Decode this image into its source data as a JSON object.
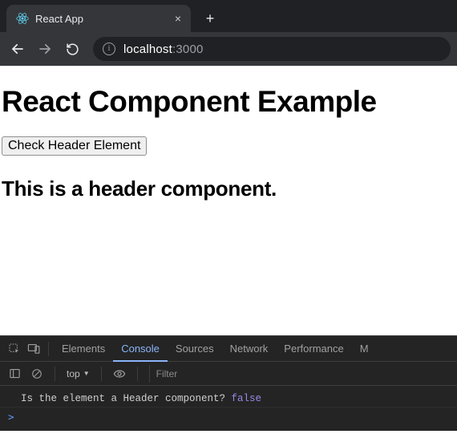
{
  "browser": {
    "tab_title": "React App",
    "url_host": "localhost",
    "url_port": ":3000"
  },
  "page": {
    "heading": "React Component Example",
    "button_label": "Check Header Element",
    "subheading": "This is a header component."
  },
  "devtools": {
    "tabs": {
      "elements": "Elements",
      "console": "Console",
      "sources": "Sources",
      "network": "Network",
      "performance": "Performance",
      "more": "M"
    },
    "context": "top",
    "filter_placeholder": "Filter",
    "log_text": "Is the element a Header component? ",
    "log_value": "false",
    "prompt": ">"
  }
}
